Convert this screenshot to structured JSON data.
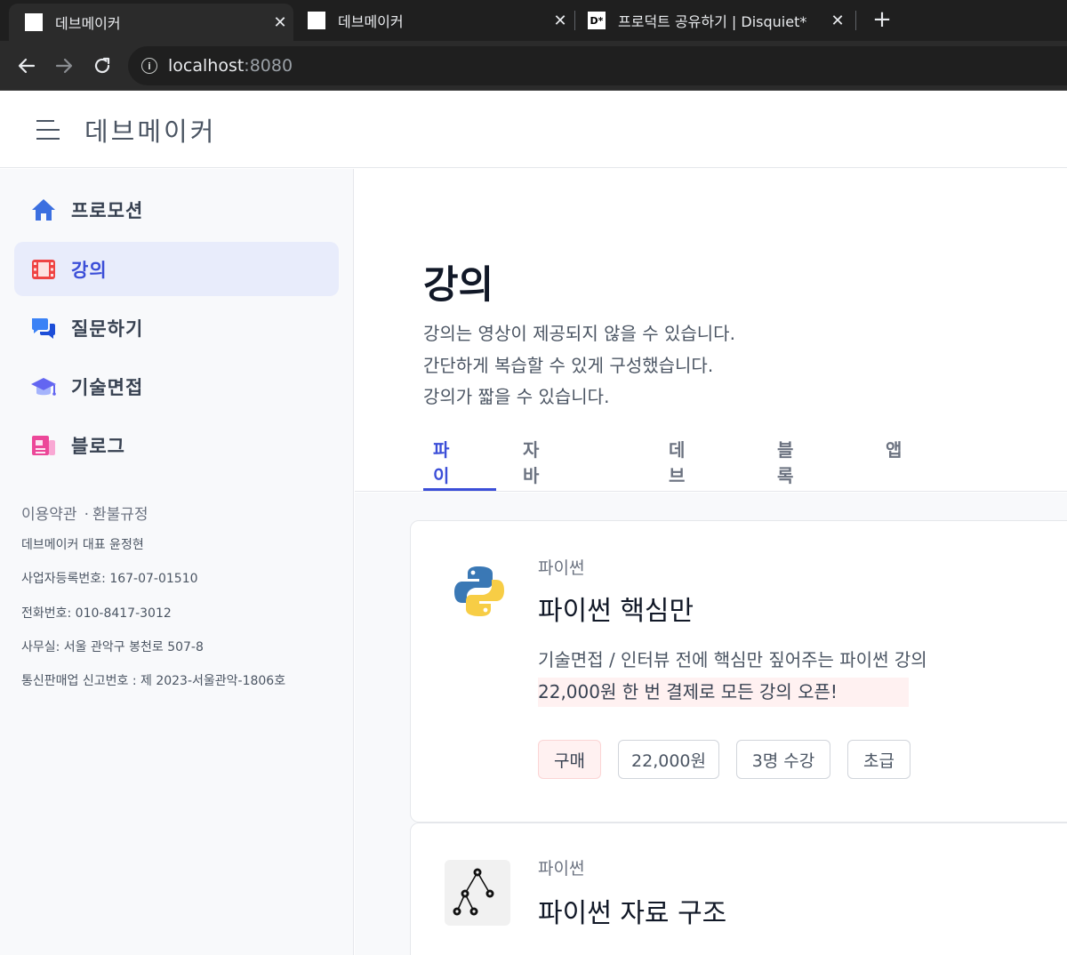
{
  "browser": {
    "tabs": [
      {
        "title": "데브메이커",
        "favicon": "white-square"
      },
      {
        "title": "데브메이커",
        "favicon": "white-square"
      },
      {
        "title": "프로덕트 공유하기 | Disquiet*",
        "favicon": "D*"
      }
    ],
    "close_glyph": "✕",
    "new_tab_glyph": "+",
    "url_host": "localhost",
    "url_port": ":8080"
  },
  "header": {
    "brand": "데브메이커"
  },
  "sidebar": {
    "items": [
      {
        "label": "프로모션",
        "icon": "home-icon",
        "color": "#3b6fe0",
        "active": false
      },
      {
        "label": "강의",
        "icon": "film-icon",
        "color": "#ef4444",
        "active": true
      },
      {
        "label": "질문하기",
        "icon": "chat-icon",
        "color": "#3b82f6",
        "active": false
      },
      {
        "label": "기술면접",
        "icon": "graduation-cap-icon",
        "color": "#6366f1",
        "active": false
      },
      {
        "label": "블로그",
        "icon": "blog-icon",
        "color": "#ec4899",
        "active": false
      }
    ],
    "footer": {
      "terms": "이용약관",
      "dot": "·",
      "refund": "환불규정",
      "lines": [
        "데브메이커 대표 윤정현",
        "사업자등록번호: 167-07-01510",
        "전화번호: 010-8417-3012",
        "사무실: 서울 관악구 봉천로 507-8",
        "통신판매업 신고번호 : 제 2023-서울관악-1806호"
      ]
    }
  },
  "main": {
    "title": "강의",
    "description": [
      "강의는 영상이 제공되지 않을 수 있습니다.",
      "간단하게 복습할 수 있게 구성했습니다.",
      "강의가 짧을 수 있습니다."
    ],
    "tabs": [
      {
        "label": "파이썬",
        "active": true
      },
      {
        "label": "자바스크립트",
        "active": false
      },
      {
        "label": "데브옵스",
        "active": false
      },
      {
        "label": "블록체인",
        "active": false
      },
      {
        "label": "앱",
        "active": false
      }
    ],
    "courses": [
      {
        "category": "파이썬",
        "title": "파이썬 핵심만",
        "description": "기술면접 / 인터뷰 전에 핵심만 짚어주는 파이썬 강의",
        "highlight": "22,000원 한 번 결제로 모든 강의 오픈!",
        "chips": [
          "구매",
          "22,000원",
          "3명 수강",
          "초급"
        ],
        "logo": "python-logo-icon"
      },
      {
        "category": "파이썬",
        "title": "파이썬 자료 구조",
        "logo": "tree-diagram-icon"
      }
    ]
  },
  "colors": {
    "accent": "#3b4ed8",
    "active_bg": "#e8ecfb",
    "highlight_bg": "#fff1f1"
  }
}
